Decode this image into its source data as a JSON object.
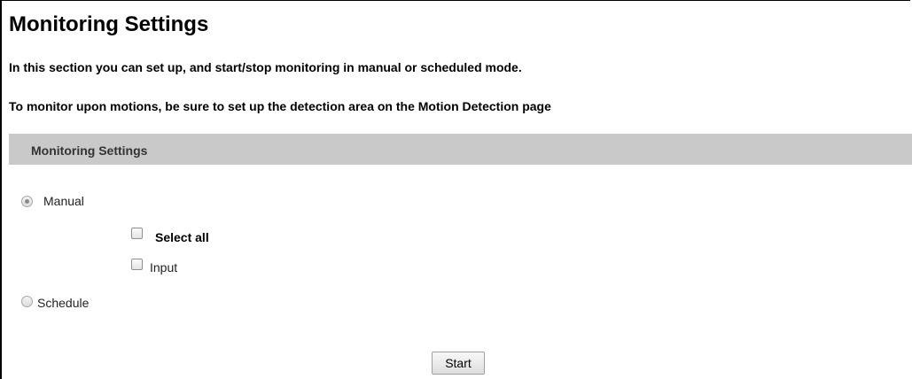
{
  "page": {
    "title": "Monitoring Settings",
    "description_1": "In this section you can set up, and start/stop monitoring in manual or scheduled mode.",
    "description_2": "To monitor upon motions, be sure to set up the detection area on the Motion Detection page"
  },
  "section": {
    "header": "Monitoring Settings"
  },
  "mode": {
    "manual_label": "Manual",
    "schedule_label": "Schedule",
    "selected": "Manual"
  },
  "manual_options": {
    "select_all_label": "Select all",
    "input_label": "Input",
    "select_all_checked": false,
    "input_checked": false
  },
  "actions": {
    "start_label": "Start"
  },
  "colors": {
    "section_bar": "#c9c9c9"
  }
}
